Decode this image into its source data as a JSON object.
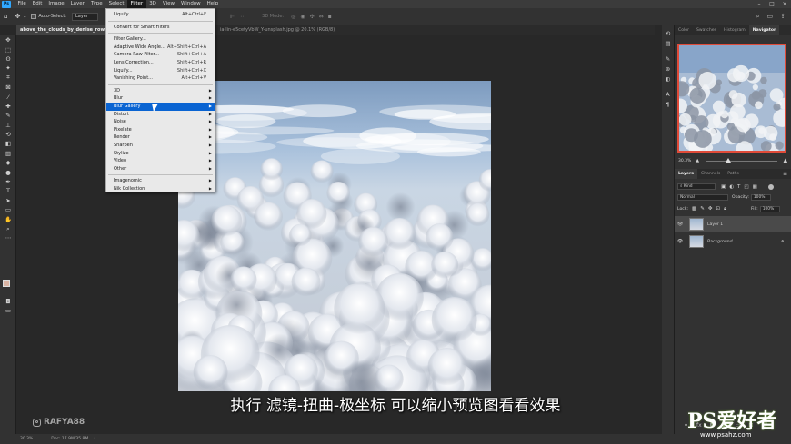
{
  "menubar": {
    "logo": "Ps",
    "items": [
      "File",
      "Edit",
      "Image",
      "Layer",
      "Type",
      "Select",
      "Filter",
      "3D",
      "View",
      "Window",
      "Help"
    ],
    "active_index": 6,
    "window_controls": [
      "–",
      "□",
      "×"
    ]
  },
  "options_bar": {
    "auto_select_label": "Auto-Select:",
    "layer_dropdown": "Layer",
    "mode_3d_label": "3D Mode:"
  },
  "document_tabs": [
    {
      "label": "above_the_clouds_by_denise_rowlands_d",
      "active": true
    },
    {
      "label": "ia-lin-e5cetyVbW_Y-unsplash.jpg @ 20.1% (RGB/8)",
      "active": false
    }
  ],
  "filter_menu": {
    "items": [
      {
        "label": "Liquify",
        "shortcut": "Alt+Ctrl+F"
      },
      {
        "sep": true
      },
      {
        "label": "Convert for Smart Filters",
        "shortcut": ""
      },
      {
        "sep": true
      },
      {
        "label": "Filter Gallery...",
        "shortcut": ""
      },
      {
        "label": "Adaptive Wide Angle...",
        "shortcut": "Alt+Shift+Ctrl+A"
      },
      {
        "label": "Camera Raw Filter...",
        "shortcut": "Shift+Ctrl+A"
      },
      {
        "label": "Lens Correction...",
        "shortcut": "Shift+Ctrl+R"
      },
      {
        "label": "Liquify...",
        "shortcut": "Shift+Ctrl+X"
      },
      {
        "label": "Vanishing Point...",
        "shortcut": "Alt+Ctrl+V"
      },
      {
        "sep": true
      },
      {
        "label": "3D",
        "submenu": true
      },
      {
        "label": "Blur",
        "submenu": true
      },
      {
        "label": "Blur Gallery",
        "submenu": true,
        "highlighted": true
      },
      {
        "label": "Distort",
        "submenu": true
      },
      {
        "label": "Noise",
        "submenu": true
      },
      {
        "label": "Pixelate",
        "submenu": true
      },
      {
        "label": "Render",
        "submenu": true
      },
      {
        "label": "Sharpen",
        "submenu": true
      },
      {
        "label": "Stylize",
        "submenu": true
      },
      {
        "label": "Video",
        "submenu": true
      },
      {
        "label": "Other",
        "submenu": true
      },
      {
        "sep": true
      },
      {
        "label": "Imagenomic",
        "submenu": true
      },
      {
        "label": "Nik Collection",
        "submenu": true
      }
    ]
  },
  "right_panel": {
    "top_tabs": [
      "Color",
      "Swatches",
      "Histogram",
      "Navigator"
    ],
    "active_top_tab": 3,
    "navigator_zoom": "30.3%",
    "navigator_zoom_fraction": 0.303,
    "layer_tabs": [
      "Layers",
      "Channels",
      "Paths"
    ],
    "kind_label": "Kind",
    "blend_mode": "Normal",
    "opacity_label": "Opacity:",
    "opacity_value": "100%",
    "lock_label": "Lock:",
    "fill_label": "Fill:",
    "fill_value": "100%",
    "layers": [
      {
        "name": "Layer 1",
        "selected": true
      },
      {
        "name": "Background",
        "selected": false,
        "locked": true
      }
    ]
  },
  "status_bar": {
    "zoom": "30.3%",
    "doc_info": "Doc: 17.9M/35.8M"
  },
  "overlay": {
    "subtitle": "执行 滤镜-扭曲-极坐标 可以缩小预览图看看效果",
    "watermark": "RAFYA88",
    "site_logo": "PS爱好者",
    "site_url": "www.psahz.com"
  }
}
